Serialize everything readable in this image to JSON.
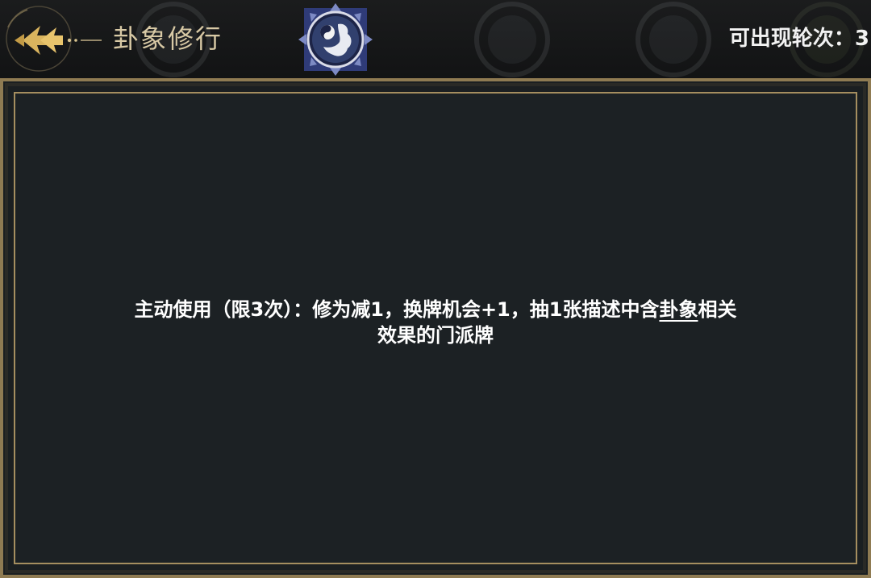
{
  "header": {
    "title": "卦象修行",
    "round_counter": {
      "label": "可出现轮次",
      "separator": "：",
      "value": "3"
    }
  },
  "description": {
    "line1_before": "主动使用（限3次）：修为减1，换牌机会+1，抽1张描述中含",
    "keyword": "卦象",
    "line1_after": "相关",
    "line2": "效果的门派牌"
  },
  "icons": {
    "back": "back-arrow-icon",
    "active_medallion": "yin-yang-figure-icon"
  },
  "colors": {
    "title": "#d8c9a5",
    "frame_gold": "#a58e5f",
    "panel_bg": "#1c2124",
    "text": "#ffffff"
  }
}
